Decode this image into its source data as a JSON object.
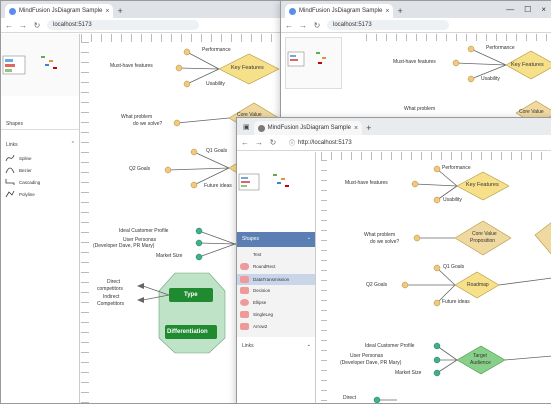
{
  "browser": {
    "tab_title": "MindFusion JsDiagram Sample",
    "url": "localhost:5173",
    "url_full": "http://localhost:5173",
    "new_tab": "+",
    "close": "×",
    "minimize": "—",
    "maximize": "☐",
    "back": "←",
    "forward": "→",
    "reload": "↻"
  },
  "sidebar": {
    "shapes_header": "Shapes",
    "links_header": "Links",
    "link_items": [
      "Spline",
      "Bezier",
      "Cascading",
      "Polyline"
    ],
    "shape_items": [
      "Text",
      "RoundRect",
      "DataTransmission",
      "Decision",
      "Ellipse",
      "SingleLeg",
      "Arrow2"
    ],
    "selected_shape": "DataTransmission"
  },
  "diagram": {
    "features": [
      "Performance",
      "Must-have features",
      "Key Features",
      "Usability"
    ],
    "problem": [
      "What problem",
      "do we solve?",
      "Core Value",
      "Proposition"
    ],
    "goals": [
      "Q1 Goals",
      "Q2 Goals",
      "Roadmap",
      "Future ideas"
    ],
    "audience": [
      "Ideal Customer Profile",
      "User Personas",
      "(Developer Dave, PR Mary)",
      "Target",
      "Audience",
      "Market Size"
    ],
    "competition": [
      "Direct",
      "competitors",
      "Indirect",
      "Competitors",
      "Type",
      "Differentiation"
    ]
  },
  "colors": {
    "diamond_yellow": "#f7e08a",
    "diamond_tan": "#f0d9a0",
    "diamond_green": "#88d08a",
    "node_green": "#1f8a30",
    "dot_tan": "#f2c97a",
    "dot_green": "#3fb08c"
  }
}
